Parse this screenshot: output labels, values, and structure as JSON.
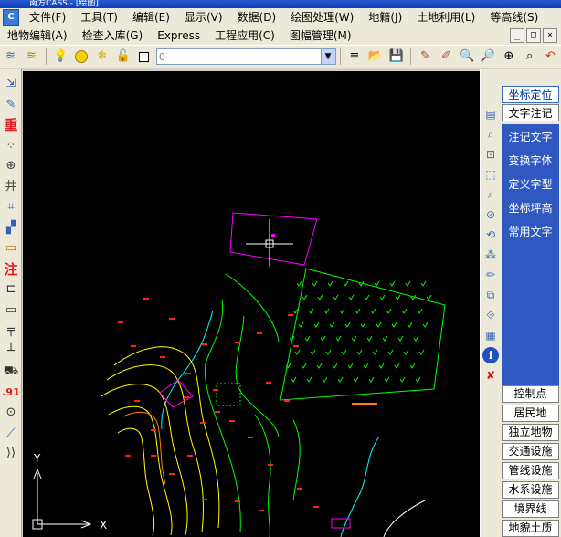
{
  "window": {
    "title": "南方CASS - [绘图]",
    "app_icon": "cass-app-icon"
  },
  "menu_row1": [
    {
      "label": "文件(F)",
      "name": "menu-file"
    },
    {
      "label": "工具(T)",
      "name": "menu-tools"
    },
    {
      "label": "编辑(E)",
      "name": "menu-edit"
    },
    {
      "label": "显示(V)",
      "name": "menu-view"
    },
    {
      "label": "数据(D)",
      "name": "menu-data"
    },
    {
      "label": "绘图处理(W)",
      "name": "menu-drawing-process"
    },
    {
      "label": "地籍(J)",
      "name": "menu-cadastre"
    },
    {
      "label": "土地利用(L)",
      "name": "menu-land-use"
    },
    {
      "label": "等高线(S)",
      "name": "menu-contour"
    }
  ],
  "menu_row2": [
    {
      "label": "地物编辑(A)",
      "name": "menu-feature-edit"
    },
    {
      "label": "检查入库(G)",
      "name": "menu-check-import"
    },
    {
      "label": "Express",
      "name": "menu-express"
    },
    {
      "label": "工程应用(C)",
      "name": "menu-engineering"
    },
    {
      "label": "图幅管理(M)",
      "name": "menu-sheet-management"
    }
  ],
  "mdi": {
    "minimize": "_",
    "restore": "□",
    "close": "×"
  },
  "toolbar": {
    "layer_value": "0",
    "colors": {
      "bulb": "#f4e23c",
      "sun": "#f5d000",
      "square": "#ffffff"
    }
  },
  "left_tools": [
    {
      "glyph": "⇲",
      "name": "tool-pointer-icon",
      "color": "#3060c0"
    },
    {
      "glyph": "✎",
      "name": "tool-edit-icon",
      "color": "#3060c0"
    },
    {
      "glyph": "重",
      "name": "tool-redraw-icon",
      "color": "#e02020"
    },
    {
      "glyph": "⁘",
      "name": "tool-points-icon",
      "color": "#444"
    },
    {
      "glyph": "⊕",
      "name": "tool-circle-icon",
      "color": "#444"
    },
    {
      "glyph": "井",
      "name": "tool-grid-icon",
      "color": "#444"
    },
    {
      "glyph": "⌗",
      "name": "tool-polygon-icon",
      "color": "#3060c0"
    },
    {
      "glyph": "▞",
      "name": "tool-hatch-icon",
      "color": "#3060c0"
    },
    {
      "glyph": "▭",
      "name": "tool-ruler-icon",
      "color": "#b08000"
    },
    {
      "glyph": "注",
      "name": "tool-annotate-icon",
      "color": "#e02020"
    },
    {
      "glyph": "⊏",
      "name": "tool-corner-icon",
      "color": "#333"
    },
    {
      "glyph": "▭",
      "name": "tool-rectangle-icon",
      "color": "#333"
    },
    {
      "glyph": "╤",
      "name": "tool-fence-icon",
      "color": "#333"
    },
    {
      "glyph": "┴",
      "name": "tool-wall-icon",
      "color": "#333"
    },
    {
      "glyph": "⛟",
      "name": "tool-vehicle-icon",
      "color": "#333"
    },
    {
      "glyph": ".91",
      "name": "tool-elevation-icon",
      "color": "#e02020"
    },
    {
      "glyph": "⊙",
      "name": "tool-target-icon",
      "color": "#333"
    },
    {
      "glyph": "⟋",
      "name": "tool-line-icon",
      "color": "#3060c0"
    },
    {
      "glyph": "⟩⟩",
      "name": "tool-expand-icon",
      "color": "#333"
    }
  ],
  "right_tools": [
    {
      "glyph": "▤",
      "name": "rt-layers-icon"
    },
    {
      "glyph": "⌕",
      "name": "rt-zoom-window-icon"
    },
    {
      "glyph": "⊡",
      "name": "rt-select-icon"
    },
    {
      "glyph": "⬚",
      "name": "rt-frame-icon"
    },
    {
      "glyph": "⌕",
      "name": "rt-zoom-in-icon"
    },
    {
      "glyph": "⊘",
      "name": "rt-zoom-out-icon"
    },
    {
      "glyph": "⟲",
      "name": "rt-rotate-icon"
    },
    {
      "glyph": "⁂",
      "name": "rt-nodes-icon"
    },
    {
      "glyph": "✏",
      "name": "rt-pencil-icon"
    },
    {
      "glyph": "⧉",
      "name": "rt-copy-icon"
    },
    {
      "glyph": "⟐",
      "name": "rt-diamond-icon"
    },
    {
      "glyph": "▦",
      "name": "rt-table-icon"
    },
    {
      "glyph": "ℹ",
      "name": "rt-info-icon"
    },
    {
      "glyph": "✘",
      "name": "rt-delete-icon"
    }
  ],
  "panel": {
    "tab_coord": "坐标定位",
    "tab_text": "文字注记",
    "list_items": [
      "注记文字",
      "变换字体",
      "定义字型",
      "坐标坪高",
      "常用文字"
    ],
    "categories": [
      "控制点",
      "居民地",
      "独立地物",
      "交通设施",
      "管线设施",
      "水系设施",
      "境界线",
      "地貌土质"
    ]
  },
  "canvas": {
    "ucs_x": "X",
    "ucs_y": "Y",
    "colors": {
      "background": "#000000",
      "magenta": "#ff00ff",
      "green": "#00ff00",
      "yellow": "#ffff00",
      "cyan": "#00ffff",
      "red": "#ff0000",
      "white": "#ffffff",
      "orange": "#ff8000"
    }
  }
}
